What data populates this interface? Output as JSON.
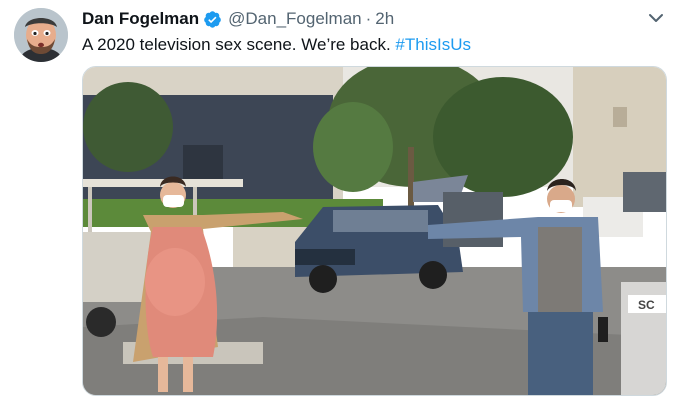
{
  "author": {
    "name": "Dan Fogelman",
    "handle": "@Dan_Fogelman",
    "separator": "·",
    "time": "2h",
    "verified": true
  },
  "tweet": {
    "text": "A 2020 television sex scene.  We’re back. ",
    "hashtag": "#ThisIsUs"
  },
  "media": {
    "bin_label": "SC"
  },
  "icons": {
    "verified": "verified-badge-icon",
    "more": "chevron-down-icon"
  },
  "colors": {
    "link": "#1d9bf0",
    "verified": "#1d9bf0",
    "secondary_text": "#536471"
  }
}
